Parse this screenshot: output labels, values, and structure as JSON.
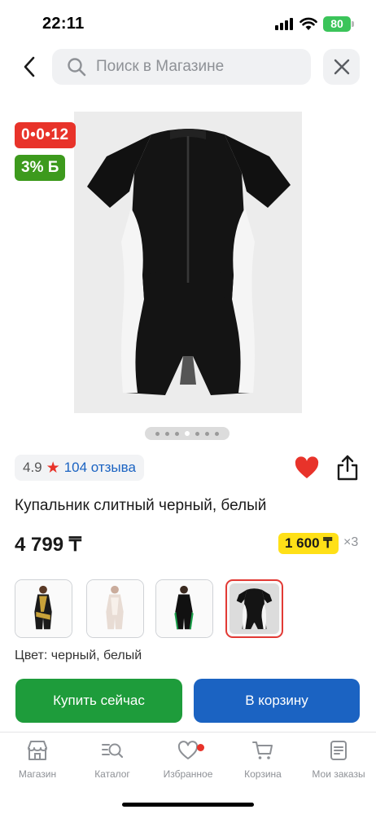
{
  "status_bar": {
    "time": "22:11",
    "battery": "80"
  },
  "search": {
    "placeholder": "Поиск в Магазине"
  },
  "badges": {
    "installment": "0•0•12",
    "bonus": "3% Б"
  },
  "gallery": {
    "total_images": 7,
    "active_index": 4
  },
  "rating": {
    "value": "4.9",
    "reviews": "104 отзыва"
  },
  "product": {
    "title": "Купальник слитный черный, белый",
    "price": "4 799 ₸",
    "installment_payment": "1 600 ₸",
    "installment_count": "×3",
    "color_label": "Цвет: черный, белый",
    "favorite": true
  },
  "color_options": [
    {
      "name": "black-gold",
      "selected": false
    },
    {
      "name": "white-beige",
      "selected": false
    },
    {
      "name": "black-green",
      "selected": false
    },
    {
      "name": "black-white",
      "selected": true
    }
  ],
  "actions": {
    "buy_now": "Купить сейчас",
    "add_to_cart": "В корзину"
  },
  "bottom_nav": [
    {
      "label": "Магазин",
      "icon": "store-icon"
    },
    {
      "label": "Каталог",
      "icon": "catalog-search-icon"
    },
    {
      "label": "Избранное",
      "icon": "heart-outline-icon",
      "has_dot": true
    },
    {
      "label": "Корзина",
      "icon": "cart-icon"
    },
    {
      "label": "Мои заказы",
      "icon": "orders-icon"
    }
  ],
  "colors": {
    "accent_red": "#e8332a",
    "bonus_green": "#3d9a1d",
    "buy_green": "#1e9c3b",
    "cart_blue": "#1b63c2",
    "installment_yellow": "#ffe017",
    "link_blue": "#1b63c2"
  }
}
